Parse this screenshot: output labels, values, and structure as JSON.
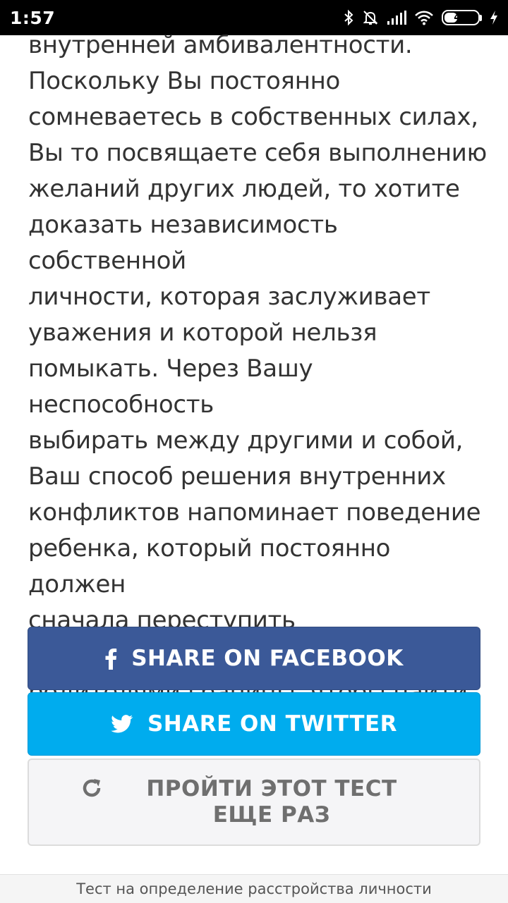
{
  "status_bar": {
    "time": "1:57",
    "battery_level": "40",
    "battery_fraction": 0.4,
    "icons": [
      "bluetooth-icon",
      "muted-bell-icon",
      "signal-icon",
      "wifi-icon",
      "battery-icon",
      "charging-bolt-icon"
    ]
  },
  "result": {
    "text": "внутренней амбивалентности.\nПоскольку Вы постоянно\nсомневаетесь в собственных силах,\nВы то посвящаете себя выполнению\nжеланий других людей, то хотите\nдоказать независимость собственной\nличности, которая заслуживает\nуважения и которой нельзя\nпомыкать. Через Вашу неспособность\nвыбирать между другими и собой,\nВаш способ решения внутренних\nконфликтов напоминает поведение\nребенка, который постоянно должен\nсначала переступить установленные\nродителями границы, чтобы найти\nсебя."
  },
  "buttons": {
    "facebook_label": "SHARE ON FACEBOOK",
    "twitter_label": "SHARE ON TWITTER",
    "retake_label": "ПРОЙТИ ЭТОТ ТЕСТ ЕЩЕ РАЗ"
  },
  "footer": {
    "title": "Тест на определение расстройства личности"
  },
  "colors": {
    "facebook": "#3b5998",
    "twitter": "#00acee",
    "retake_bg": "#f5f5f7",
    "text": "#333333"
  }
}
